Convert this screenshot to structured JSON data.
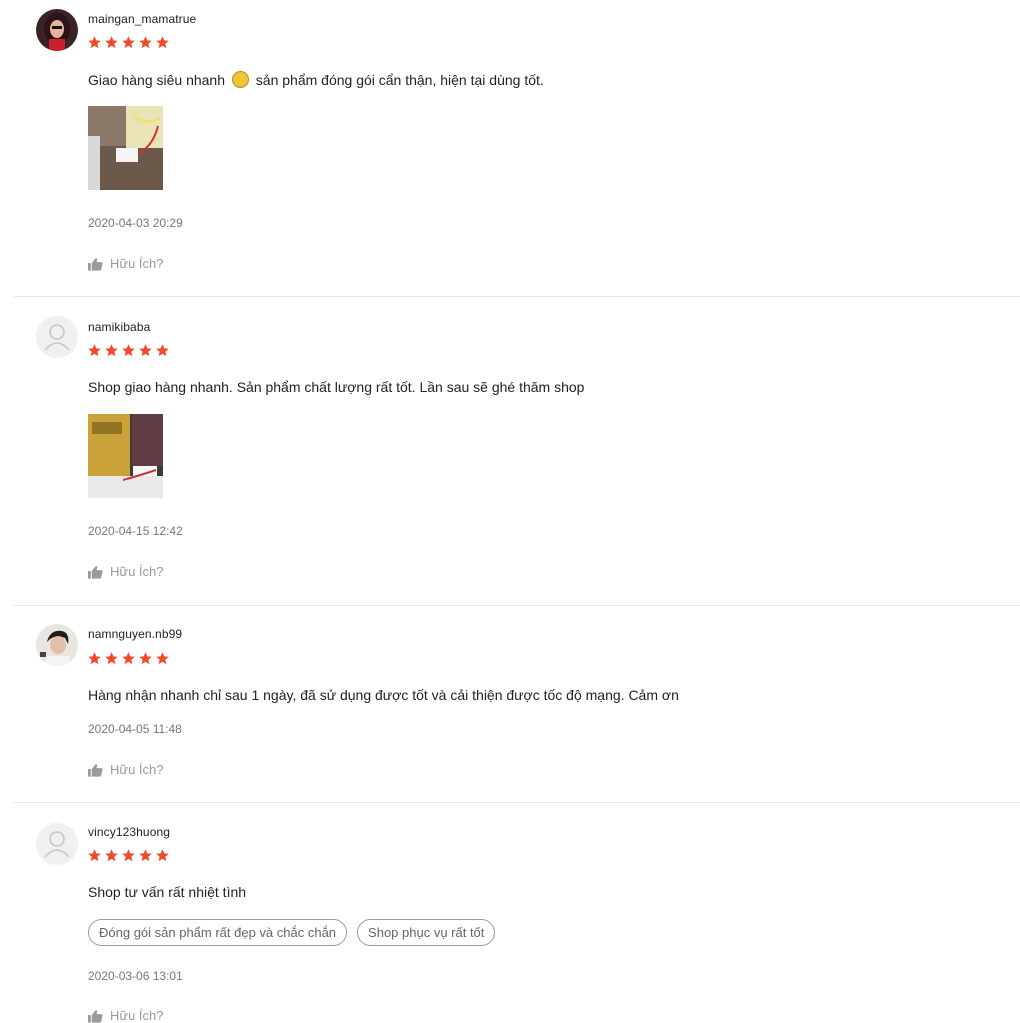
{
  "reviews": [
    {
      "username": "maingan_mamatrue",
      "rating": 5,
      "comment_before": "Giao hàng siêu nhanh",
      "emoji": "smile-emoji",
      "comment_after": "sản phẩm đóng gói cẩn thận, hiện tại dùng tốt.",
      "time": "2020-04-03 20:29",
      "helpful_label": "Hữu Ích?"
    },
    {
      "username": "namikibaba",
      "rating": 5,
      "comment": "Shop giao hàng nhanh. Sản phẩm chất lượng rất tốt. Lần sau sẽ ghé thăm shop",
      "time": "2020-04-15 12:42",
      "helpful_label": "Hữu Ích?"
    },
    {
      "username": "namnguyen.nb99",
      "rating": 5,
      "comment": "Hàng nhận nhanh chỉ sau 1 ngày, đã sử dụng được tốt và cải thiện được tốc độ mạng. Cảm ơn",
      "time": "2020-04-05 11:48",
      "helpful_label": "Hữu Ích?"
    },
    {
      "username": "vincy123huong",
      "rating": 5,
      "comment": "Shop tư vấn rất nhiệt tình",
      "tags": [
        "Đóng gói sản phẩm rất đẹp và chắc chắn",
        "Shop phục vụ rất tốt"
      ],
      "time": "2020-03-06 13:01",
      "helpful_label": "Hữu Ích?"
    }
  ],
  "colors": {
    "star": "#ee4d2d",
    "muted": "#9a9a9a",
    "divider": "#e6e6e6"
  },
  "icons": {
    "star": "star-icon",
    "thumbs_up": "thumbs-up-icon",
    "default_avatar": "user-icon"
  }
}
